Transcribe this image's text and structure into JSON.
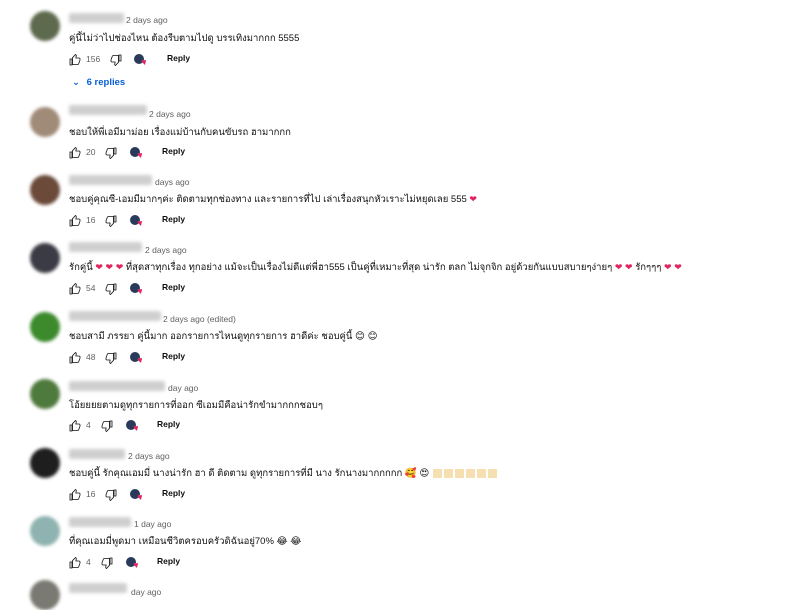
{
  "comments": [
    {
      "time": "2 days ago",
      "text": "คู่นี้ไม่ว่าไปช่องไหน ต้องรีบตามไปดู บรรเทิงมากกก 5555",
      "likes": "156",
      "avatar_color": "#5e6a4e",
      "reply_label": "Reply"
    },
    {
      "time": "2 days ago",
      "text": "ชอบให้พี่เอมีมาม่อย เรื่องแม่บ้านกับคนขับรถ ฮามากกก",
      "likes": "20",
      "avatar_color": "#a08a78",
      "reply_label": "Reply"
    },
    {
      "time": "days ago",
      "text": "ชอบคู่คุณซี-เอมมีมากๆค่ะ ติดตามทุกช่องทาง และรายการที่ไป เล่าเรื่องสนุกหัวเราะไม่หยุดเลย 555",
      "likes": "16",
      "avatar_color": "#6b4a3a",
      "reply_label": "Reply"
    },
    {
      "time": "2 days ago",
      "text": "ที่สุดสาทุกเรื่อง ทุกอย่าง แม้จะเป็นเรื่องไม่ดีแต่พี่ฮา555 เป็นคู่ที่เหมาะที่สุด น่ารัก ตลก ไม่จุกจิก อยู่ด้วยกันแบบสบายๆง่ายๆ",
      "text_prefix": "รักคู่นี้",
      "text_suffix": "รักๆๆๆ",
      "likes": "54",
      "avatar_color": "#3b3b45",
      "reply_label": "Reply"
    },
    {
      "time": "2 days ago (edited)",
      "text": "ชอบสามี ภรรยา คู่นี้มาก ออกรายการไหนดูทุกรายการ ฮาดีค่ะ ชอบคู่นี้",
      "likes": "48",
      "avatar_color": "#3c8a2c",
      "reply_label": "Reply"
    },
    {
      "time": "day ago",
      "text": "โอ้ยยยยตามดูทุกรายการที่ออก ซีเอมมีคือน่ารักขำมากกกชอบๆ",
      "likes": "4",
      "avatar_color": "#4f7a3e",
      "reply_label": "Reply"
    },
    {
      "time": "2 days ago",
      "text": "ชอบคู่นี้ รักคุณเอมมี่ นางน่ารัก ฮา ดี ติดตาม ดูทุกรายการที่มี นาง รักนางมากกกกก",
      "likes": "16",
      "avatar_color": "#1e1e1e",
      "reply_label": "Reply"
    },
    {
      "time": "1 day ago",
      "text": "ที่คุณเอมมี่พูดมา เหมือนชีวิตครอบครัวดิฉันอยู่70%",
      "likes": "4",
      "avatar_color": "#8fb3b0",
      "reply_label": "Reply"
    },
    {
      "time": "day ago",
      "avatar_color": "#7a7a72"
    }
  ],
  "replies_toggle": "6 replies",
  "emoji_heart": "❤",
  "emoji_smile": "😊",
  "emoji_laugh": "😂",
  "emoji_love": "🥰",
  "emoji_hearteyes": "😍"
}
